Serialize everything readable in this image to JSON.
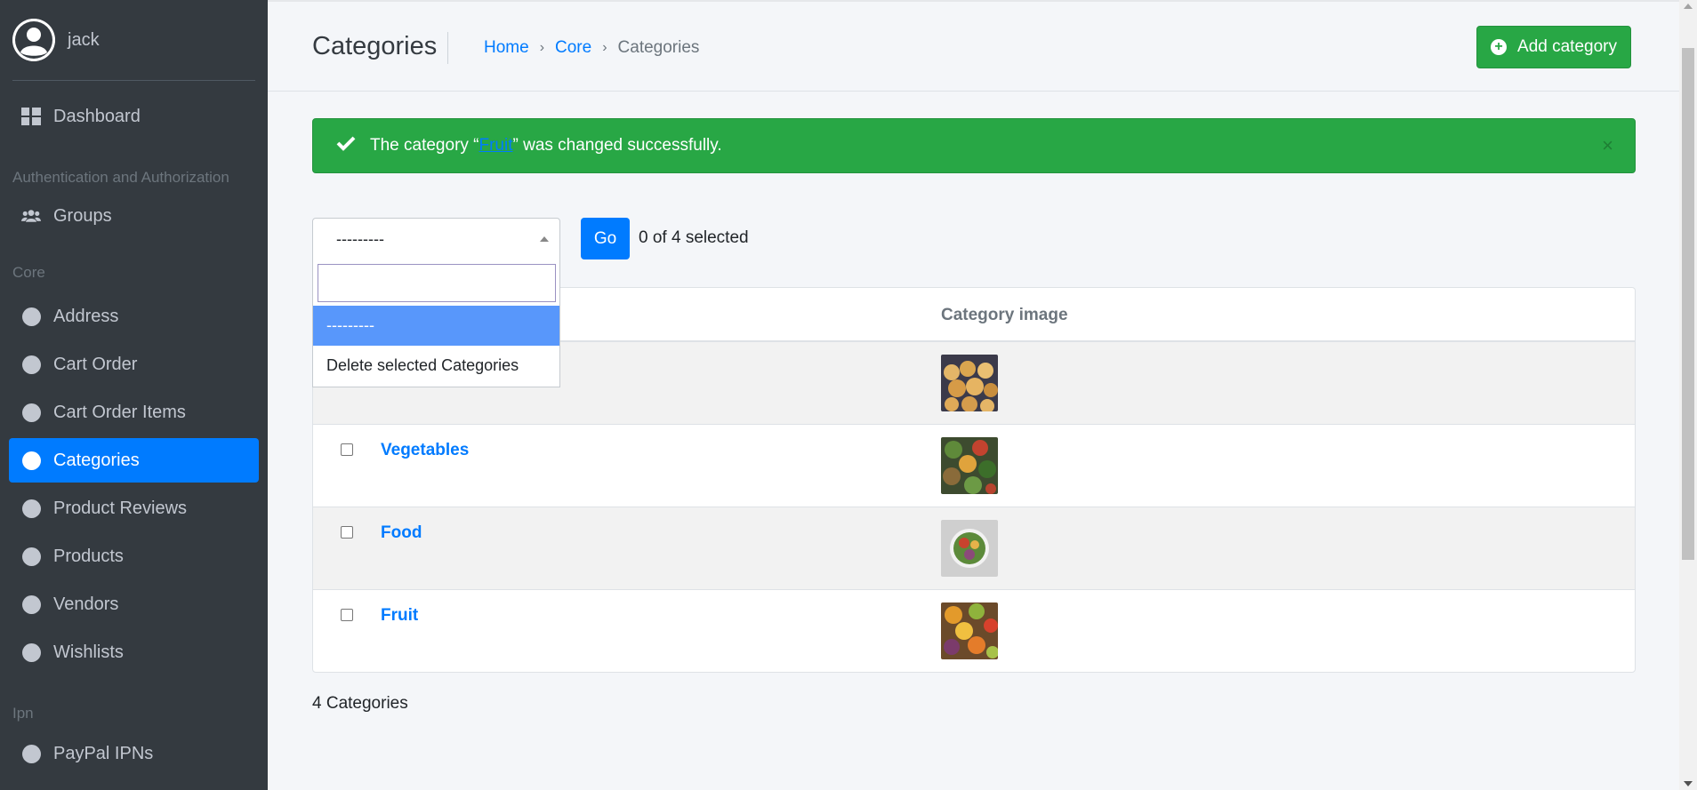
{
  "user": {
    "name": "jack"
  },
  "sidebar": {
    "dashboard": "Dashboard",
    "section_auth": "Authentication and Authorization",
    "groups": "Groups",
    "section_core": "Core",
    "core_items": [
      "Address",
      "Cart Order",
      "Cart Order Items",
      "Categories",
      "Product Reviews",
      "Products",
      "Vendors",
      "Wishlists"
    ],
    "section_ipn": "Ipn",
    "paypal": "PayPal IPNs"
  },
  "header": {
    "title": "Categories",
    "breadcrumb": {
      "home": "Home",
      "core": "Core",
      "current": "Categories"
    },
    "add_button": "Add category"
  },
  "alert": {
    "prefix": "The category “",
    "link": "Fruit",
    "suffix": "” was changed successfully.",
    "close": "×"
  },
  "actions": {
    "selected_value": "---------",
    "go": "Go",
    "count": "0 of 4 selected",
    "options": [
      "---------",
      "Delete selected Categories"
    ]
  },
  "table": {
    "col_image": "Category image",
    "rows": [
      {
        "name": ""
      },
      {
        "name": "Vegetables"
      },
      {
        "name": "Food"
      },
      {
        "name": "Fruit"
      }
    ]
  },
  "footer": {
    "total": "4 Categories"
  }
}
